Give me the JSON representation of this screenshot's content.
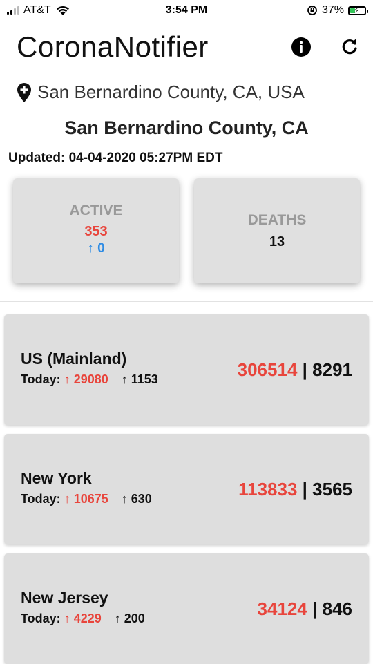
{
  "status_bar": {
    "carrier": "AT&T",
    "time": "3:54 PM",
    "battery_pct": "37%",
    "battery_level": 0.37,
    "icons": [
      "signal-icon",
      "wifi-icon",
      "orientation-lock-icon",
      "battery-charging-icon"
    ]
  },
  "header": {
    "title": "CoronaNotifier",
    "icons": [
      "info-icon",
      "refresh-icon"
    ]
  },
  "location": {
    "icon": "location-pin-plus-icon",
    "text": "San Bernardino County, CA, USA"
  },
  "county": {
    "title": "San Bernardino County, CA",
    "updated": "Updated: 04-04-2020 05:27PM EDT"
  },
  "stats": {
    "active": {
      "label": "ACTIVE",
      "value": "353",
      "delta": "↑ 0"
    },
    "deaths": {
      "label": "DEATHS",
      "value": "13"
    }
  },
  "regions": [
    {
      "name": "US (Mainland)",
      "today_label": "Today:",
      "today_cases": "↑ 29080",
      "today_deaths": "↑ 1153",
      "total_cases": "306514",
      "separator": "|",
      "total_deaths": "8291"
    },
    {
      "name": "New York",
      "today_label": "Today:",
      "today_cases": "↑ 10675",
      "today_deaths": "↑ 630",
      "total_cases": "113833",
      "separator": "|",
      "total_deaths": "3565"
    },
    {
      "name": "New Jersey",
      "today_label": "Today:",
      "today_cases": "↑ 4229",
      "today_deaths": "↑ 200",
      "total_cases": "34124",
      "separator": "|",
      "total_deaths": "846"
    }
  ],
  "colors": {
    "red": "#e8453c",
    "blue": "#2f8ce4",
    "card_bg": "#e0e0e0"
  }
}
